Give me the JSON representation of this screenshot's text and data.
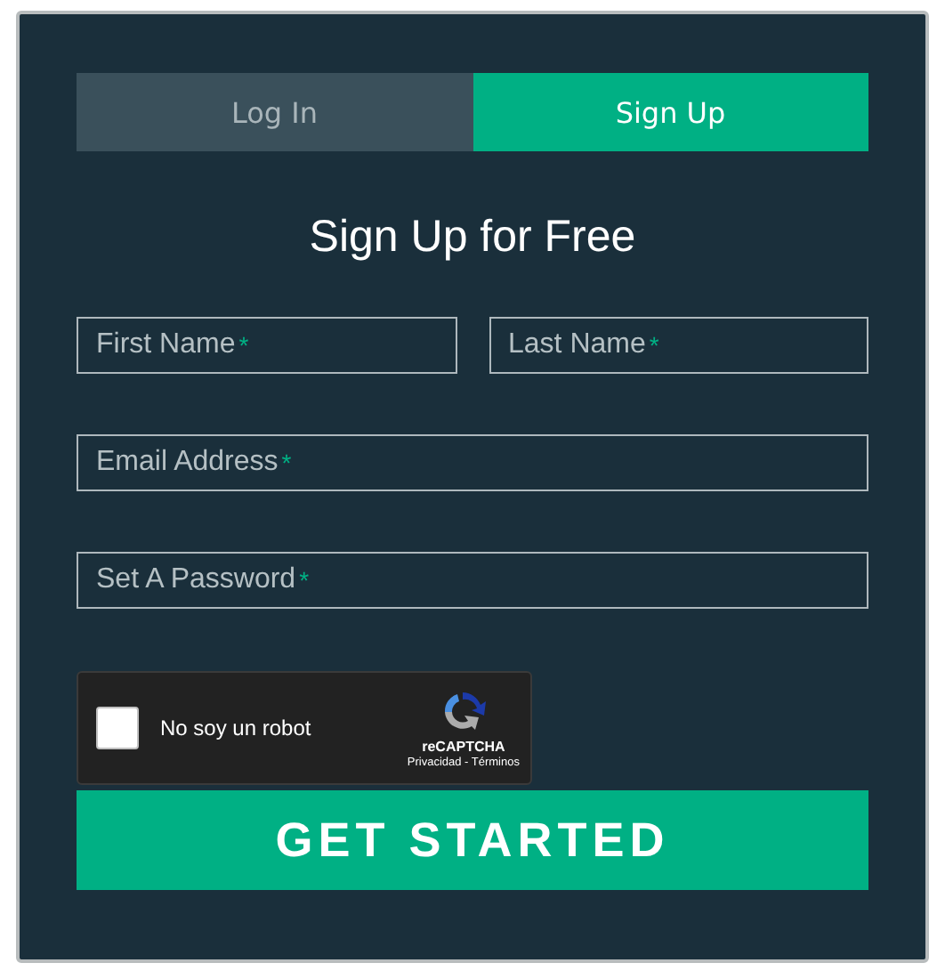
{
  "tabs": [
    {
      "label": "Log In",
      "selected": false
    },
    {
      "label": "Sign Up",
      "selected": true
    }
  ],
  "title": "Sign Up for Free",
  "fields": [
    [
      {
        "placeholder": "First Name",
        "required_mark": "*"
      },
      {
        "placeholder": "Last Name",
        "required_mark": "*"
      }
    ],
    [
      {
        "placeholder": "Email Address",
        "required_mark": "*"
      }
    ],
    [
      {
        "placeholder": "Set A Password",
        "required_mark": "*"
      }
    ]
  ],
  "captcha": {
    "checked": false,
    "label": "No soy un robot",
    "brand": "reCAPTCHA",
    "links": "Privacidad - Términos"
  },
  "submit": "GET STARTED"
}
